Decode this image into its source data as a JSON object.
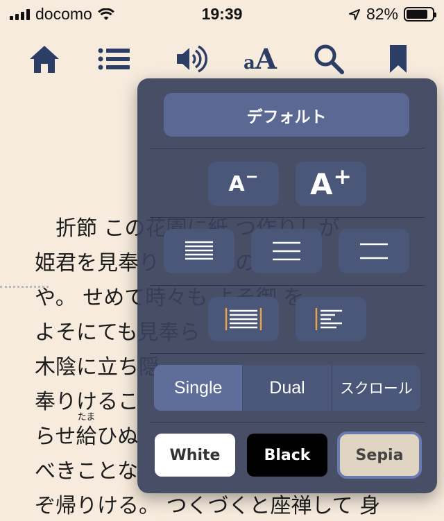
{
  "status": {
    "carrier": "docomo",
    "time": "19:39",
    "battery": "82%",
    "battery_level": 0.82
  },
  "toolbar": {
    "font_icon_label_small": "a",
    "font_icon_label_large": "A"
  },
  "page_text": {
    "line1": "　折節 この花園に紙 つ作りしが",
    "line2": "姫君を見奉り らんや の御",
    "line3": "や。 せめて時々も よそ御 を",
    "line4": "よそにても見奉ら と 、",
    "line5": "木陰に立ち隠 ",
    "line6": "奉りけるこ ",
    "line7_pre": "らせ",
    "line7_ruby_base": "給",
    "line7_ruby": "たま",
    "line7_post": "ひぬ",
    "line8": "べきことな ",
    "line9": "ぞ帰りける。 つくづくと座禅して 身"
  },
  "panel": {
    "default_label": "デフォルト",
    "font_smaller": "A",
    "font_smaller_sup": "−",
    "font_larger": "A",
    "font_larger_sup": "+",
    "view_modes": [
      "Single",
      "Dual",
      "スクロール"
    ],
    "view_mode_selected": "Single",
    "themes": [
      "White",
      "Black",
      "Sepia"
    ],
    "theme_selected": "Sepia"
  },
  "colors": {
    "background": "#f6ebdd",
    "toolbar_icon": "#2d3e66",
    "panel_bg": "#39425c",
    "button_bg": "#4b5778",
    "accent": "#6a7bb0"
  }
}
